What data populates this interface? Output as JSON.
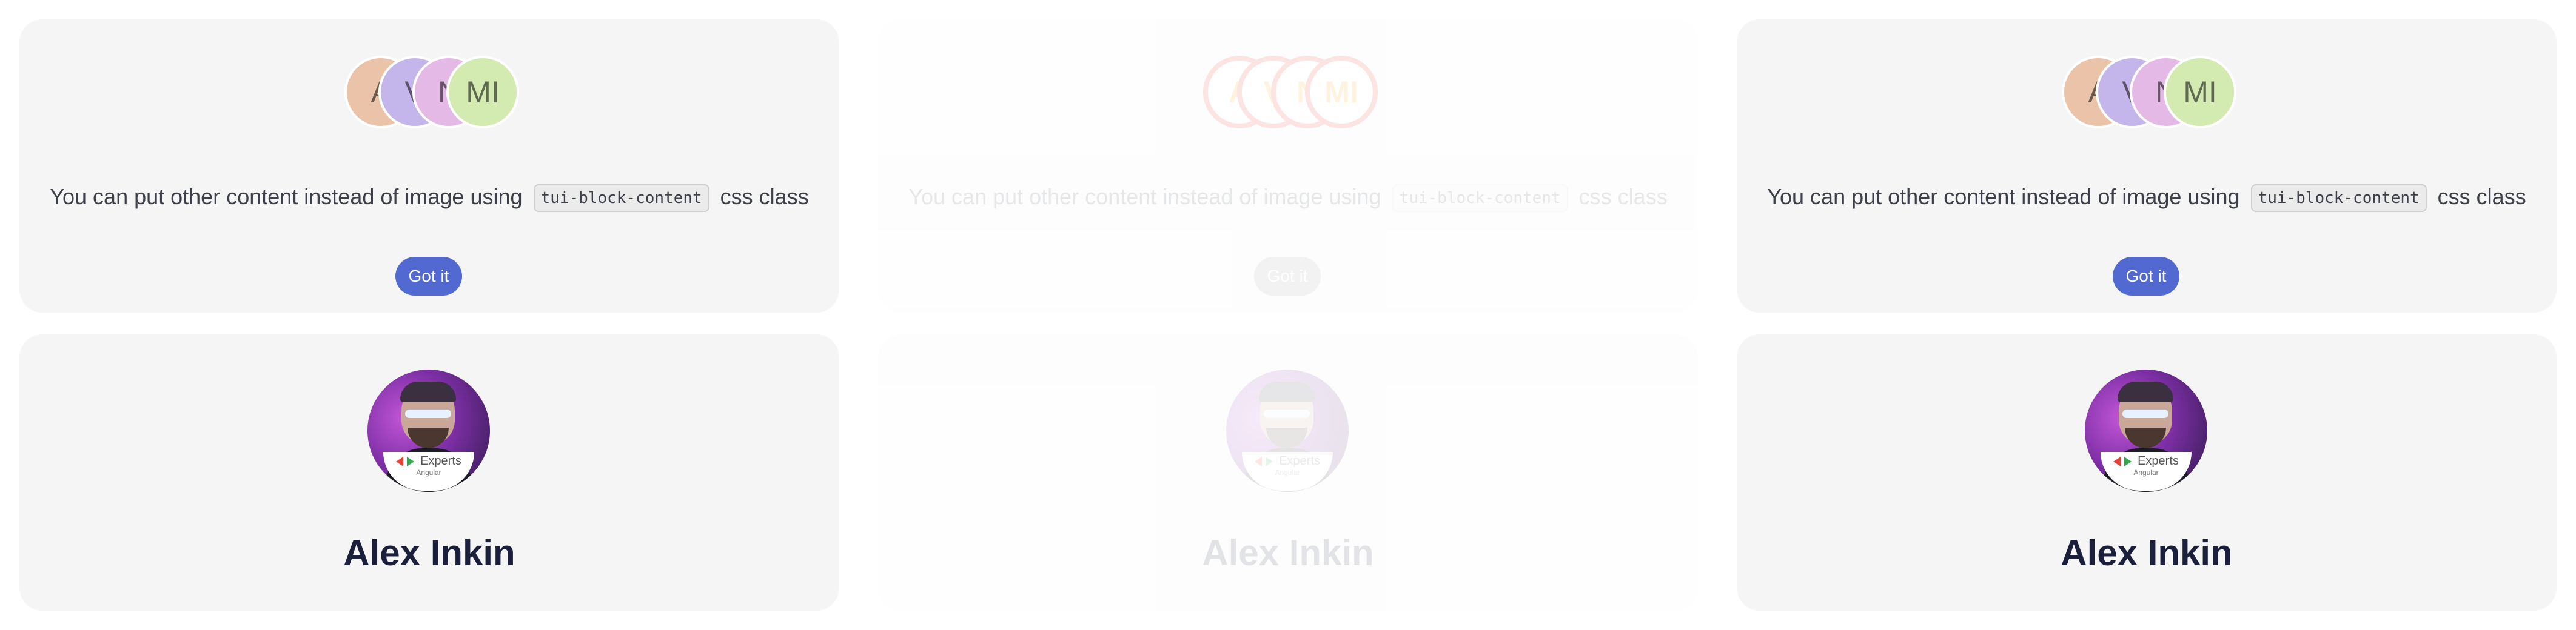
{
  "avatars": [
    "A",
    "V",
    "N",
    "MI"
  ],
  "content_line": {
    "before": "You can put other content instead of image using",
    "code": "tui-block-content",
    "after": "css class"
  },
  "got_it_label": "Got it",
  "profile": {
    "badge_title": "Experts",
    "badge_sub": "Angular",
    "name": "Alex Inkin"
  }
}
